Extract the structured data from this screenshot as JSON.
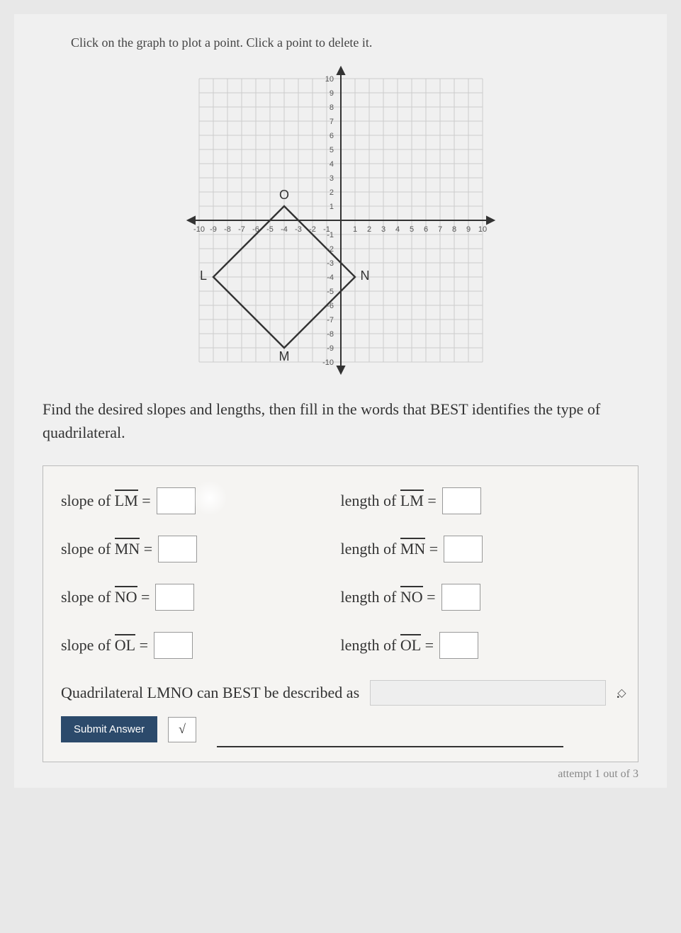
{
  "instruction": "Click on the graph to plot a point. Click a point to delete it.",
  "body_text": "Find the desired slopes and lengths, then fill in the words that BEST identifies the type of quadrilateral.",
  "labels": {
    "slope_lm": "slope of ",
    "seg_lm": "LM",
    "eq": " = ",
    "slope_mn": "slope of ",
    "seg_mn": "MN",
    "slope_no": "slope of ",
    "seg_no": "NO",
    "slope_ol": "slope of ",
    "seg_ol": "OL",
    "length_lm": "length of ",
    "length_mn": "length of ",
    "length_no": "length of ",
    "length_ol": "length of "
  },
  "quad_text": "Quadrilateral LMNO can BEST be described as",
  "period": ".",
  "submit": "Submit Answer",
  "sqrt": "√",
  "attempt": "attempt 1 out of 3",
  "chart_data": {
    "type": "scatter",
    "title": "",
    "xlabel": "",
    "ylabel": "",
    "xlim": [
      -10,
      10
    ],
    "ylim": [
      -10,
      10
    ],
    "x_ticks": [
      -10,
      -9,
      -8,
      -7,
      -6,
      -5,
      -4,
      -3,
      -2,
      -1,
      1,
      2,
      3,
      4,
      5,
      6,
      7,
      8,
      9,
      10
    ],
    "y_ticks": [
      -10,
      -9,
      -8,
      -7,
      -6,
      -5,
      -4,
      -3,
      -2,
      -1,
      1,
      2,
      3,
      4,
      5,
      6,
      7,
      8,
      9,
      10
    ],
    "grid": true,
    "points": {
      "L": {
        "x": -9,
        "y": -4
      },
      "M": {
        "x": -4,
        "y": -9
      },
      "N": {
        "x": 1,
        "y": -4
      },
      "O": {
        "x": -4,
        "y": 1
      }
    },
    "shape": "quadrilateral",
    "vertices_order": [
      "L",
      "M",
      "N",
      "O"
    ]
  }
}
